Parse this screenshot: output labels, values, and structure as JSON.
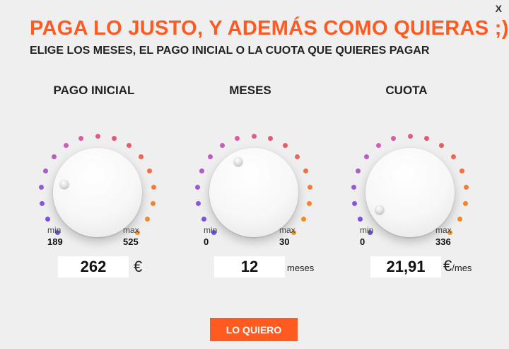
{
  "close_label": "X",
  "title": "PAGA LO JUSTO, Y ADEMÁS COMO QUIERAS ;)",
  "subtitle": "ELIGE LOS MESES, EL PAGO INICIAL O LA CUOTA QUE QUIERES PAGAR",
  "dials": [
    {
      "label": "PAGO INICIAL",
      "min_label": "min",
      "min_value": "189",
      "max_label": "max",
      "max_value": "525",
      "value": "262",
      "unit_main": "€",
      "unit_suffix": "",
      "level": 0.22
    },
    {
      "label": "MESES",
      "min_label": "min",
      "min_value": "0",
      "max_label": "max",
      "max_value": "30",
      "value": "12",
      "unit_main": "",
      "unit_suffix": "meses",
      "level": 0.4
    },
    {
      "label": "CUOTA",
      "min_label": "min",
      "min_value": "0",
      "max_label": "max",
      "max_value": "336",
      "value": "21,91",
      "unit_main": "€",
      "unit_suffix": "/mes",
      "level": 0.06
    }
  ],
  "cta_label": "LO QUIERO",
  "colors": {
    "accent": "#ff5a1f",
    "dot_gradient": [
      "#6a4ee6",
      "#9b59d6",
      "#d65fb3",
      "#e8566b",
      "#f27a3a",
      "#f0931f"
    ]
  }
}
